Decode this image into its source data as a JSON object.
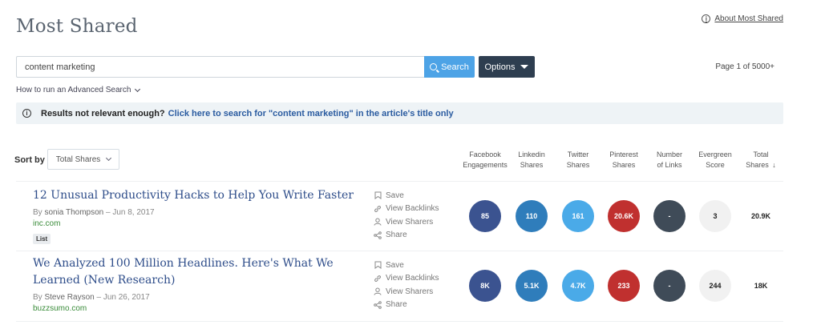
{
  "header": {
    "title": "Most Shared",
    "about_link": "About Most Shared"
  },
  "search": {
    "value": "content marketing",
    "button_label": "Search",
    "options_label": "Options"
  },
  "pagination": {
    "page_info": "Page 1 of 5000+"
  },
  "advanced_search": {
    "label": "How to run an Advanced Search"
  },
  "notice": {
    "prefix": "Results not relevant enough?",
    "link": "Click here to search for \"content marketing\" in the article's title only"
  },
  "sort": {
    "label": "Sort by",
    "selected": "Total Shares"
  },
  "columns": {
    "facebook": [
      "Facebook",
      "Engagements"
    ],
    "linkedin": [
      "Linkedin",
      "Shares"
    ],
    "twitter": [
      "Twitter",
      "Shares"
    ],
    "pinterest": [
      "Pinterest",
      "Shares"
    ],
    "links": [
      "Number",
      "of Links"
    ],
    "evergreen": [
      "Evergreen",
      "Score"
    ],
    "total": [
      "Total",
      "Shares"
    ],
    "total_arrow": "↓"
  },
  "actions": {
    "save": "Save",
    "backlinks": "View Backlinks",
    "sharers": "View Sharers",
    "share": "Share"
  },
  "colors": {
    "facebook": "#3b5390",
    "linkedin": "#2f7dbb",
    "twitter": "#4aaae8",
    "pinterest": "#c0302f",
    "links": "#3f4b58",
    "evergreen": "#f1f1f1"
  },
  "articles": [
    {
      "title": "12 Unusual Productivity Hacks to Help You Write Faster",
      "by": "By",
      "author": "sonia Thompson",
      "date": "– Jun 8, 2017",
      "domain": "inc.com",
      "tag": "List",
      "facebook": "85",
      "linkedin": "110",
      "twitter": "161",
      "pinterest": "20.6K",
      "links": "-",
      "evergreen": "3",
      "total": "20.9K"
    },
    {
      "title": "We Analyzed 100 Million Headlines. Here's What We Learned (New Research)",
      "by": "By",
      "author": "Steve Rayson",
      "date": "– Jun 26, 2017",
      "domain": "buzzsumo.com",
      "tag": "",
      "facebook": "8K",
      "linkedin": "5.1K",
      "twitter": "4.7K",
      "pinterest": "233",
      "links": "-",
      "evergreen": "244",
      "total": "18K"
    }
  ]
}
